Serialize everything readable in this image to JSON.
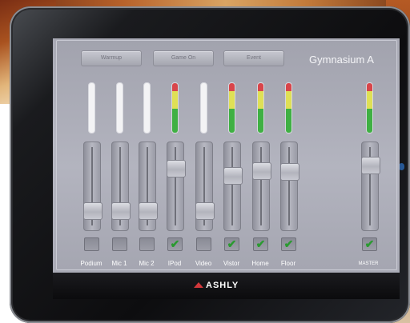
{
  "screen": {
    "room_title": "Gymnasium A",
    "presets": [
      {
        "label": "Warmup"
      },
      {
        "label": "Game On"
      },
      {
        "label": "Event"
      }
    ]
  },
  "channels": [
    {
      "label": "Podium",
      "level": 0.15,
      "meter": "idle",
      "checked": false
    },
    {
      "label": "Mic 1",
      "level": 0.15,
      "meter": "idle",
      "checked": false
    },
    {
      "label": "Mic 2",
      "level": 0.15,
      "meter": "idle",
      "checked": false
    },
    {
      "label": "IPod",
      "level": 0.75,
      "meter": "active",
      "checked": true
    },
    {
      "label": "Video",
      "level": 0.15,
      "meter": "idle",
      "checked": false
    },
    {
      "label": "Vistor",
      "level": 0.65,
      "meter": "active",
      "checked": true
    },
    {
      "label": "Home",
      "level": 0.72,
      "meter": "active",
      "checked": true
    },
    {
      "label": "Floor",
      "level": 0.7,
      "meter": "active",
      "checked": true
    }
  ],
  "master": {
    "label": "MASTER",
    "level": 0.8,
    "meter": "active",
    "checked": true
  },
  "footer": {
    "brand": "ASHLY"
  },
  "icons": {
    "check": "checkmark-icon",
    "logo": "ashly-logo-icon"
  },
  "colors": {
    "meter_red": "#d8454a",
    "meter_yellow": "#dfe055",
    "meter_green": "#3fb043",
    "check_green": "#2a9a30"
  }
}
